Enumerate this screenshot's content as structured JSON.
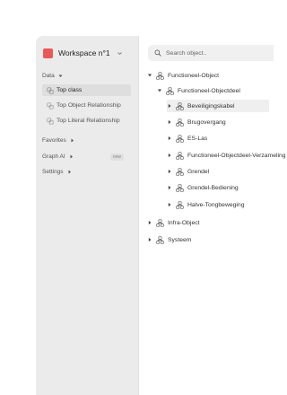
{
  "workspace": {
    "name": "Workspace n°1",
    "logo_color": "#e8595c"
  },
  "sidebar": {
    "data_section": {
      "label": "Data"
    },
    "items": [
      {
        "label": "Top class",
        "active": true,
        "icon": "class-icon"
      },
      {
        "label": "Top Object Relationship",
        "active": false,
        "icon": "relationship-icon"
      },
      {
        "label": "Top Literal Relationship",
        "active": false,
        "icon": "relationship-icon"
      }
    ],
    "favorites": {
      "label": "Favorites"
    },
    "graph_ai": {
      "label": "Graph AI",
      "badge": "new"
    },
    "settings": {
      "label": "Settings"
    }
  },
  "search": {
    "placeholder": "Search object.."
  },
  "tree": [
    {
      "label": "Functioneel-Object",
      "expanded": true,
      "level": 0
    },
    {
      "label": "Functioneel-Objectdeel",
      "expanded": true,
      "level": 1
    },
    {
      "label": "Beveiligingskabel",
      "expanded": false,
      "level": 2,
      "selected": true
    },
    {
      "label": "Brugovergang",
      "expanded": false,
      "level": 2
    },
    {
      "label": "ES-Las",
      "expanded": false,
      "level": 2
    },
    {
      "label": "Functioneel-Objectdeel-Verzameling",
      "expanded": false,
      "level": 2
    },
    {
      "label": "Grendel",
      "expanded": false,
      "level": 2
    },
    {
      "label": "Grendel-Bediening",
      "expanded": false,
      "level": 2
    },
    {
      "label": "Halve-Tongbeweging",
      "expanded": false,
      "level": 2
    },
    {
      "label": "Infra-Object",
      "expanded": false,
      "level": 0
    },
    {
      "label": "Systeem",
      "expanded": false,
      "level": 0
    }
  ]
}
